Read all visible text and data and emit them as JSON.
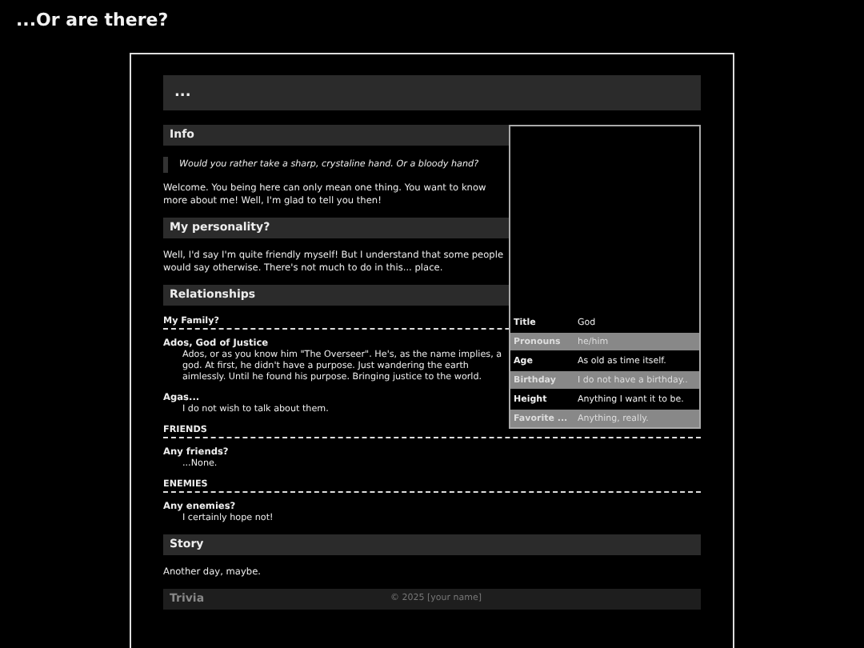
{
  "page_title": "...Or are there?",
  "header": "...",
  "infobox": {
    "rows": [
      {
        "label": "Title",
        "value": "God"
      },
      {
        "label": "Pronouns",
        "value": "he/him"
      },
      {
        "label": "Age",
        "value": "As old as time itself."
      },
      {
        "label": "Birthday",
        "value": "I do not have a birthday.."
      },
      {
        "label": "Height",
        "value": "Anything I want it to be."
      },
      {
        "label": "Favorite ...",
        "value": "Anything, really."
      }
    ]
  },
  "content": [
    {
      "kind": "heading",
      "text": "Info"
    },
    {
      "kind": "quote",
      "text": "Would you rather take a sharp, crystaline hand. Or a bloody hand?"
    },
    {
      "kind": "paragraph",
      "text": "Welcome. You being here can only mean one thing. You want to know more about me! Well, I'm glad to tell you then!"
    },
    {
      "kind": "heading",
      "text": "My personality?"
    },
    {
      "kind": "paragraph",
      "text": "Well, I'd say I'm quite friendly myself! But I understand that some people would say otherwise. There's not much to do in this... place."
    },
    {
      "kind": "heading",
      "text": "Relationships"
    },
    {
      "kind": "subheading",
      "text": "My Family?"
    },
    {
      "kind": "entry",
      "name": "Ados, God of Justice",
      "text": "Ados, or as you know him \"The Overseer\". He's, as the name implies, a god. At first, he didn't have a purpose. Just wandering the earth aimlessly. Until he found his purpose. Bringing justice to the world."
    },
    {
      "kind": "entry",
      "name": "Agas...",
      "text": "I do not wish to talk about them."
    },
    {
      "kind": "subheading",
      "text": "FRIENDS"
    },
    {
      "kind": "entry",
      "name": "Any friends?",
      "text": "...None."
    },
    {
      "kind": "subheading",
      "text": "ENEMIES"
    },
    {
      "kind": "entry",
      "name": "Any enemies?",
      "text": "I certainly hope not!"
    },
    {
      "kind": "heading",
      "text": "Story"
    },
    {
      "kind": "paragraph",
      "text": "Another day, maybe."
    }
  ],
  "footer_heading": "Trivia",
  "copyright": "© 2025 [your name]"
}
